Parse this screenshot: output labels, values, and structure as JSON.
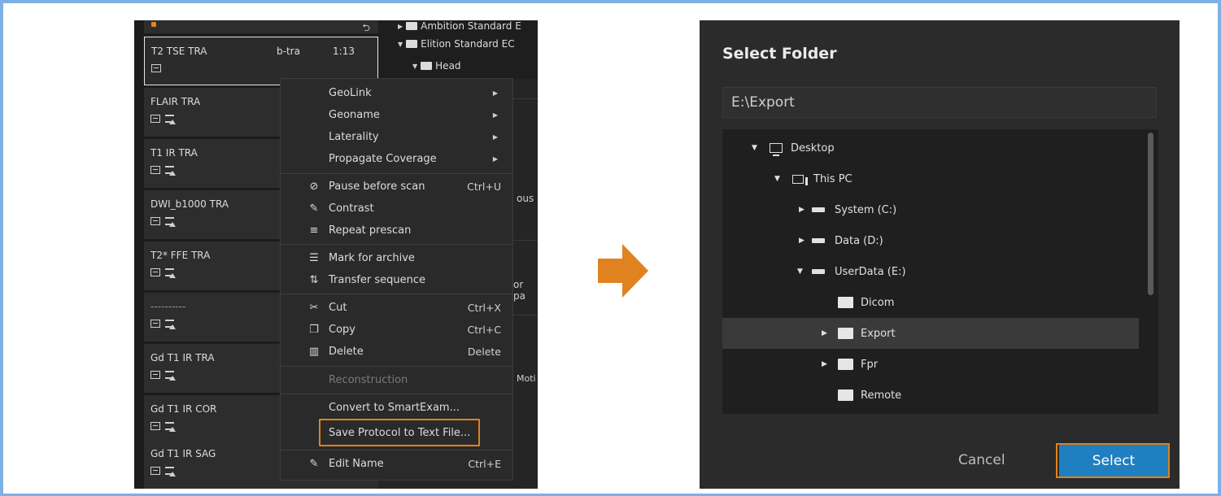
{
  "colors": {
    "accent_orange": "#e0821f",
    "select_blue": "#1f7fc1",
    "frame_blue": "#7eb0e3"
  },
  "left": {
    "sequences": [
      {
        "name": "T2 TSE TRA",
        "plane": "b-tra",
        "duration": "1:13",
        "selected": true
      },
      {
        "name": "FLAIR TRA"
      },
      {
        "name": "T1 IR TRA"
      },
      {
        "name": "DWI_b1000 TRA"
      },
      {
        "name": "T2* FFE TRA"
      },
      {
        "name": "----------"
      },
      {
        "name": "Gd T1 IR TRA"
      },
      {
        "name": "Gd T1 IR COR"
      },
      {
        "name": "Gd T1 IR SAG"
      }
    ],
    "tree": [
      {
        "label": "Ambition Standard E"
      },
      {
        "label": "Elition Standard EC"
      },
      {
        "label": "Head"
      }
    ],
    "peek": [
      "ous",
      "or pa",
      "Moti"
    ],
    "menu": {
      "items": [
        {
          "label": "GeoLink",
          "submenu": true
        },
        {
          "label": "Geoname",
          "submenu": true
        },
        {
          "label": "Laterality",
          "submenu": true
        },
        {
          "label": "Propagate Coverage",
          "submenu": true
        },
        {
          "label": "Pause before scan",
          "shortcut": "Ctrl+U",
          "icon": "pause-scan-icon"
        },
        {
          "label": "Contrast",
          "icon": "contrast-syringe-icon"
        },
        {
          "label": "Repeat prescan",
          "icon": "repeat-prescan-icon"
        },
        {
          "label": "Mark for archive",
          "icon": "archive-icon"
        },
        {
          "label": "Transfer sequence",
          "icon": "transfer-icon"
        },
        {
          "label": "Cut",
          "shortcut": "Ctrl+X",
          "icon": "scissors-icon"
        },
        {
          "label": "Copy",
          "shortcut": "Ctrl+C",
          "icon": "copy-icon"
        },
        {
          "label": "Delete",
          "shortcut": "Delete",
          "icon": "trash-icon"
        },
        {
          "label": "Reconstruction",
          "disabled": true
        },
        {
          "label": "Convert to SmartExam..."
        },
        {
          "label": "Save Protocol to Text File..."
        },
        {
          "label": "Edit Name",
          "shortcut": "Ctrl+E",
          "icon": "pencil-icon"
        }
      ]
    }
  },
  "dialog": {
    "title": "Select Folder",
    "path": "E:\\Export",
    "tree": [
      {
        "label": "Desktop",
        "icon": "desktop-icon",
        "expanded": true
      },
      {
        "label": "This PC",
        "icon": "pc-icon",
        "expanded": true
      },
      {
        "label": "System (C:)",
        "icon": "drive-icon"
      },
      {
        "label": "Data (D:)",
        "icon": "drive-icon"
      },
      {
        "label": "UserData (E:)",
        "icon": "drive-icon",
        "expanded": true
      },
      {
        "label": "Dicom",
        "icon": "folder-icon"
      },
      {
        "label": "Export",
        "icon": "folder-icon",
        "selected": true
      },
      {
        "label": "Fpr",
        "icon": "folder-icon"
      },
      {
        "label": "Remote",
        "icon": "folder-icon"
      }
    ],
    "cancel_label": "Cancel",
    "select_label": "Select"
  }
}
